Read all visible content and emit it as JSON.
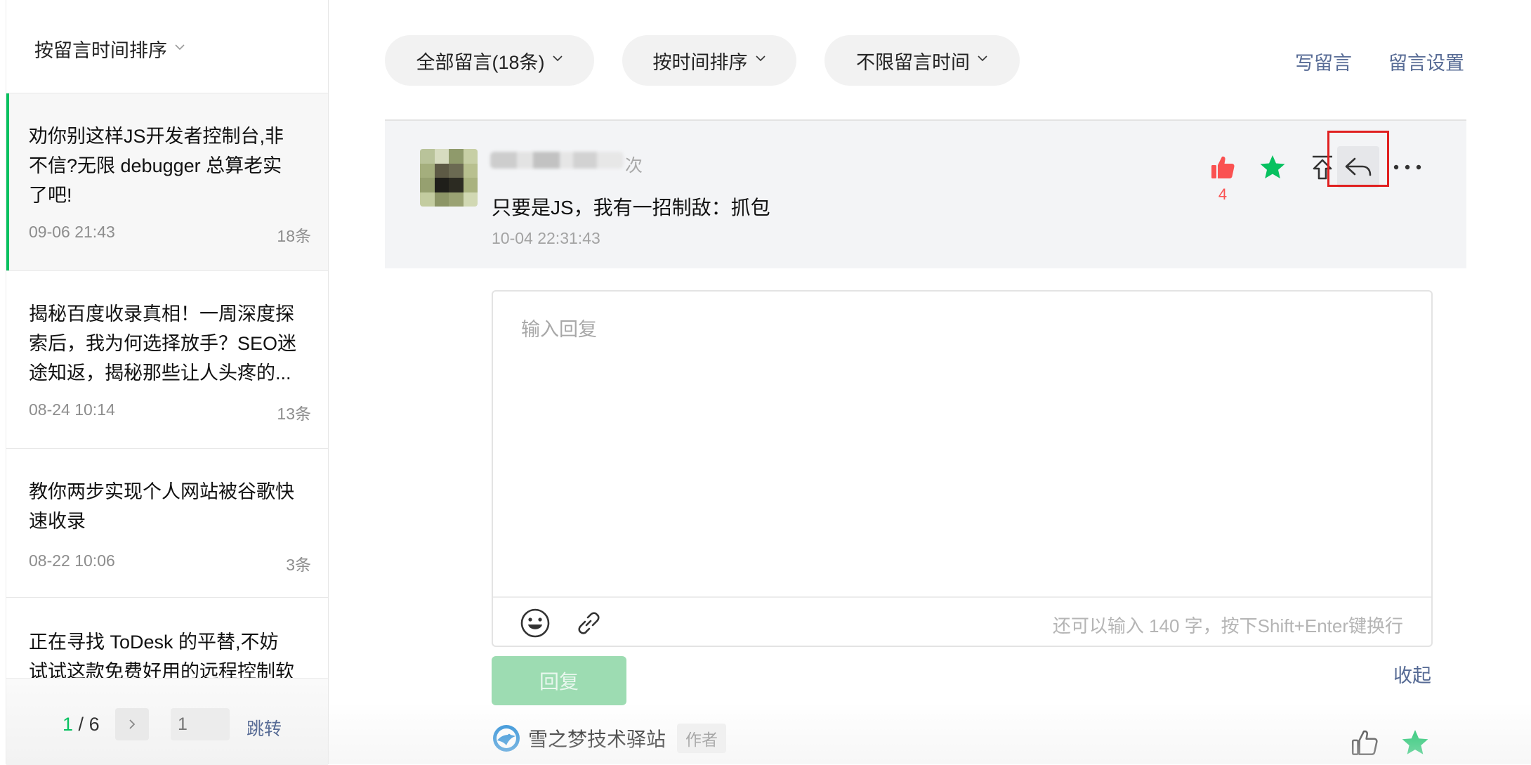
{
  "left_panel": {
    "sort_label": "按留言时间排序",
    "articles": [
      {
        "lines": [
          "劝你别这样JS开发者控制台,非",
          "不信?无限 debugger 总算老实",
          "了吧!"
        ],
        "date": "09-06 21:43",
        "count": "18条"
      },
      {
        "lines": [
          "揭秘百度收录真相！一周深度探",
          "索后，我为何选择放手？SEO迷",
          "途知返，揭秘那些让人头疼的..."
        ],
        "date": "08-24 10:14",
        "count": "13条"
      },
      {
        "lines": [
          "教你两步实现个人网站被谷歌快",
          "速收录"
        ],
        "date": "08-22 10:06",
        "count": "3条"
      },
      {
        "lines": [
          "正在寻找 ToDesk 的平替,不妨",
          "试试这款免费好用的远程控制软"
        ],
        "date": "",
        "count": ""
      }
    ],
    "pager": {
      "current": "1",
      "separator": "/",
      "total": "6",
      "input_placeholder": "1",
      "jump_label": "跳转"
    }
  },
  "filters": {
    "all_comments": "全部留言(18条)",
    "sort_by_time": "按时间排序",
    "time_range": "不限留言时间"
  },
  "top_links": {
    "write": "写留言",
    "settings": "留言设置"
  },
  "comment": {
    "nickname_suffix": "次",
    "text": "只要是JS，我有一招制敌：抓包",
    "time": "10-04 22:31:43",
    "like_count": "4"
  },
  "reply_editor": {
    "placeholder": "输入回复",
    "hint": "还可以输入 140 字，按下Shift+Enter键换行",
    "submit_label": "回复",
    "collapse_label": "收起"
  },
  "author_reply": {
    "name": "雪之梦技术驿站",
    "badge": "作者"
  },
  "colors": {
    "accent_green": "#07c160",
    "link_blue": "#576b95",
    "like_red": "#fa5151",
    "highlight_red": "#e02020"
  }
}
